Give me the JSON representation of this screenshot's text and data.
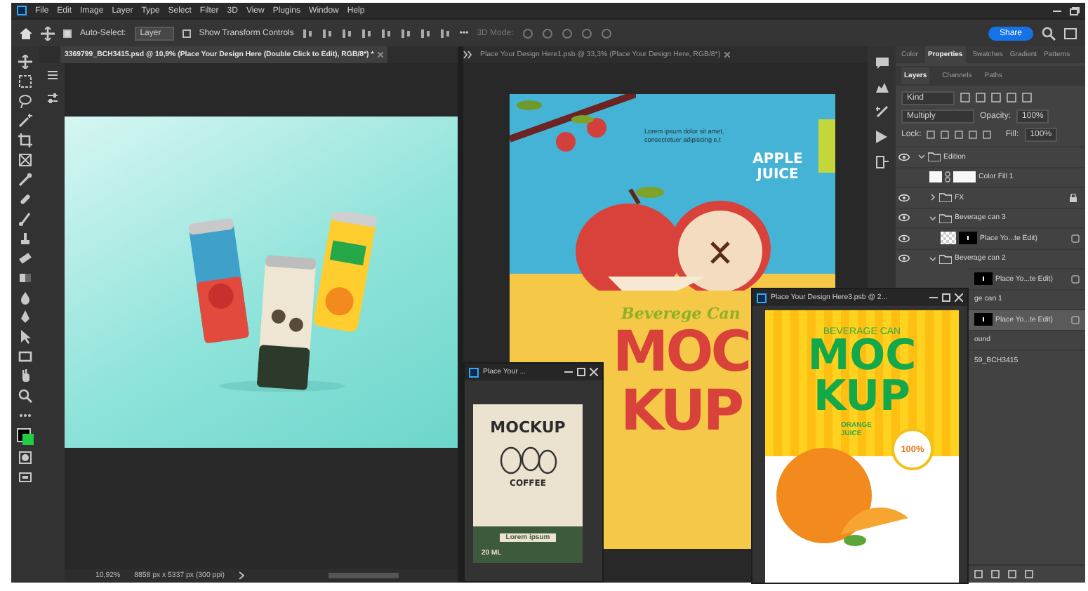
{
  "menu": [
    "File",
    "Edit",
    "Image",
    "Layer",
    "Type",
    "Select",
    "Filter",
    "3D",
    "View",
    "Plugins",
    "Window",
    "Help"
  ],
  "options_bar": {
    "auto_select": {
      "label": "Auto-Select:",
      "checked": true
    },
    "auto_select_target": "Layer",
    "transform_controls": {
      "label": "Show Transform Controls",
      "checked": false
    },
    "more": "•••",
    "mode": {
      "label": "3D Mode:",
      "disabled": true
    },
    "share": "Share"
  },
  "document_tabs": [
    {
      "label": "3369799_BCH3415.psd @ 10,9% (Place Your Design Here (Double Click to Edit), RGB/8*) *",
      "selected": true
    },
    {
      "label": "Place Your Design Here1.psb @ 33,3% (Place Your Design Here, RGB/8*)",
      "selected": false
    }
  ],
  "status_bar": {
    "zoom": "10,92%",
    "dimensions": "8858 px x 5337 px (300 ppi)"
  },
  "apple_design": {
    "caption": "Lorem ipsum dolor sit amet, consectetuer adipiscing e.t",
    "title": "APPLE JUICE",
    "subtitle": "Beverege Can",
    "headline": [
      "MOC",
      "KUP"
    ]
  },
  "coffee_window": {
    "title": "Place Your ...",
    "headline": "MOCKUP",
    "product": "COFFEE",
    "footer": "Lorem ipsum",
    "volume": "20 ML"
  },
  "orange_window": {
    "title": "Place Your Design Here3.psb @ 2...",
    "subtitle": "BEVERAGE CAN",
    "headline": [
      "MOC",
      "KUP"
    ],
    "flavor": "ORANGE JUICE",
    "badge": "100%"
  },
  "panel": {
    "tabs": [
      {
        "label": "Color",
        "selected": false
      },
      {
        "label": "Properties",
        "selected": true
      },
      {
        "label": "Swatches",
        "selected": false
      },
      {
        "label": "Gradient",
        "selected": false
      },
      {
        "label": "Patterns",
        "selected": false
      }
    ],
    "layer_tabs": [
      {
        "label": "Layers",
        "selected": true
      },
      {
        "label": "Channels",
        "selected": false
      },
      {
        "label": "Paths",
        "selected": false
      }
    ],
    "filter": "Kind",
    "blend_mode": "Multiply",
    "opacity_label": "Opacity:",
    "opacity": "100%",
    "lock_label": "Lock:",
    "fill_label": "Fill:",
    "fill": "100%",
    "layers": [
      {
        "name": "Edition",
        "kind": "group",
        "visible": true,
        "expanded": true,
        "selected": false,
        "locked": false,
        "children": [
          {
            "name": "Color Fill 1",
            "kind": "fill",
            "visible": false,
            "selected": false,
            "locked": false
          },
          {
            "name": "FX",
            "kind": "group",
            "visible": true,
            "expanded": false,
            "selected": false,
            "locked": true
          },
          {
            "name": "Beverage can 3",
            "kind": "group",
            "visible": true,
            "expanded": true,
            "selected": false,
            "locked": false,
            "children": [
              {
                "name": "Place Yo...te Edit)",
                "kind": "layer",
                "visible": true,
                "selected": false,
                "locked": false
              }
            ]
          },
          {
            "name": "Beverage can 2",
            "kind": "group",
            "visible": true,
            "expanded": true,
            "selected": false,
            "locked": false,
            "children": [
              {
                "name": "Place Yo...te Edit)",
                "kind": "layer",
                "selected": false,
                "locked": false
              }
            ]
          },
          {
            "name": "ge can 1",
            "kind": "group",
            "selected": false,
            "locked": false,
            "children": [
              {
                "name": "Place Yo...te Edit)",
                "kind": "layer",
                "selected": true,
                "locked": false
              }
            ]
          }
        ]
      },
      {
        "name": "ound",
        "kind": "group",
        "selected": false,
        "locked": false
      },
      {
        "name": "59_BCH3415",
        "kind": "group",
        "selected": false,
        "locked": false
      }
    ]
  }
}
